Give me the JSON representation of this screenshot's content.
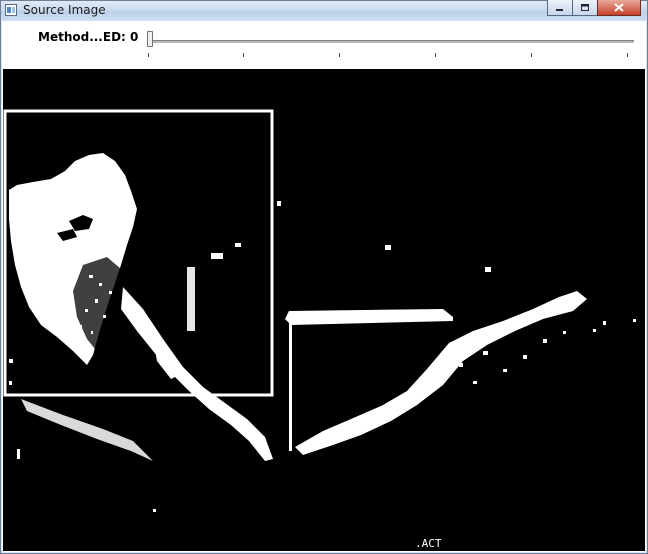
{
  "window": {
    "title": "Source Image",
    "controls": {
      "minimize": "minimize-icon",
      "maximize": "maximize-icon",
      "close": "close-icon"
    }
  },
  "trackbar": {
    "label": "Method...ED: 0",
    "value": 0,
    "ticks": 6
  },
  "image": {
    "description_colors": {
      "background": "#000000",
      "foreground": "#ffffff"
    },
    "overlay_text": ".ACT"
  }
}
